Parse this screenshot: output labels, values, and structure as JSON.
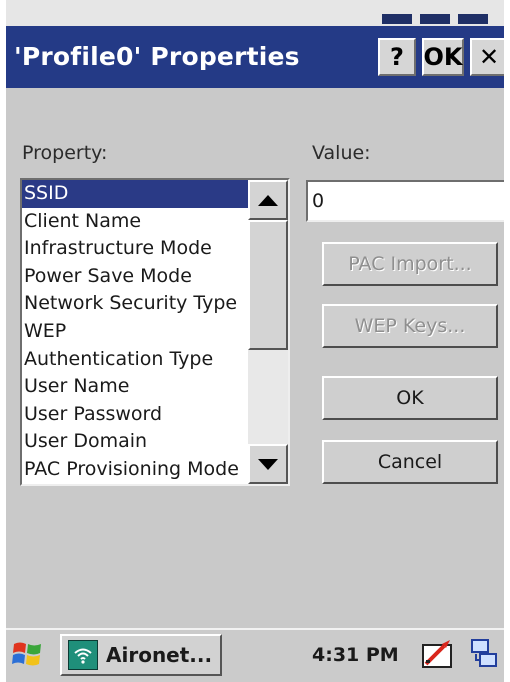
{
  "window": {
    "title": "'Profile0' Properties",
    "help_label": "?",
    "ok_label": "OK",
    "close_label": "✕"
  },
  "property_label": "Property:",
  "value_label": "Value:",
  "properties": [
    "SSID",
    "Client Name",
    "Infrastructure Mode",
    "Power Save Mode",
    "Network Security Type",
    "WEP",
    "Authentication Type",
    "User Name",
    "User Password",
    "User Domain",
    "PAC Provisioning Mode"
  ],
  "selected_property": "SSID",
  "value": "0",
  "buttons": {
    "pac_import": "PAC Import...",
    "wep_keys": "WEP Keys...",
    "ok": "OK",
    "cancel": "Cancel"
  },
  "taskbar": {
    "task_label": "Aironet...",
    "clock": "4:31 PM"
  },
  "colors": {
    "titlebar": "#243a86",
    "selection": "#2a3a86",
    "dialog_bg": "#c9c9c9"
  }
}
